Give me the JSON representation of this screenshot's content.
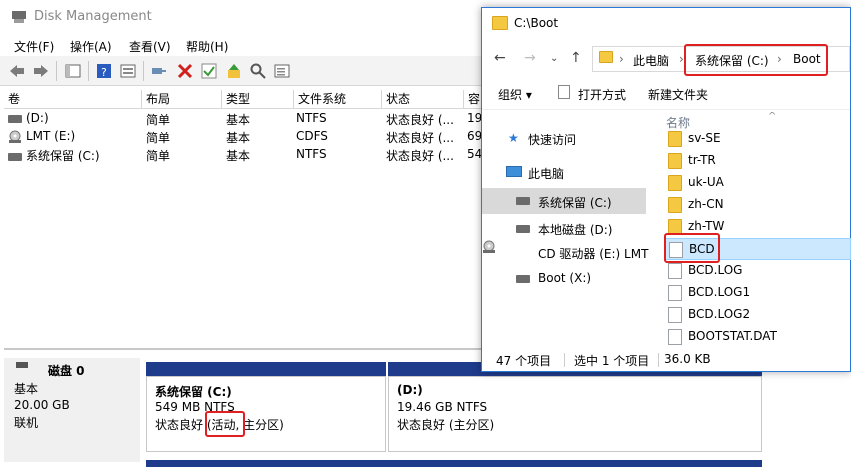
{
  "disk_management": {
    "title": "Disk Management",
    "menu": [
      "文件(F)",
      "操作(A)",
      "查看(V)",
      "帮助(H)"
    ],
    "columns": [
      "卷",
      "布局",
      "类型",
      "文件系统",
      "状态",
      "容"
    ],
    "volumes": [
      {
        "name": "(D:)",
        "layout": "简单",
        "type": "基本",
        "fs": "NTFS",
        "status": "状态良好 (...",
        "cap": "19"
      },
      {
        "name": "LMT (E:)",
        "layout": "简单",
        "type": "基本",
        "fs": "CDFS",
        "status": "状态良好 (...",
        "cap": "69"
      },
      {
        "name": "系统保留 (C:)",
        "layout": "简单",
        "type": "基本",
        "fs": "NTFS",
        "status": "状态良好 (...",
        "cap": "54"
      }
    ],
    "disk": {
      "name": "磁盘 0",
      "type": "基本",
      "size": "20.00 GB",
      "state": "联机"
    },
    "partitions": [
      {
        "name": "系统保留  (C:)",
        "size": "549 MB NTFS",
        "status": "状态良好 (活动, 主分区)"
      },
      {
        "name": "(D:)",
        "size": "19.46 GB NTFS",
        "status": "状态良好 (主分区)"
      }
    ]
  },
  "explorer": {
    "title": "C:\\Boot",
    "address": [
      "此电脑",
      "系统保留 (C:)",
      "Boot"
    ],
    "commands": {
      "organize": "组织",
      "open_with": "打开方式",
      "new_folder": "新建文件夹"
    },
    "nav": [
      {
        "label": "快速访问",
        "icon": "star-icon"
      },
      {
        "label": "此电脑",
        "icon": "computer-icon"
      },
      {
        "label": "系统保留 (C:)",
        "icon": "drive-icon",
        "selected": true
      },
      {
        "label": "本地磁盘 (D:)",
        "icon": "drive-icon"
      },
      {
        "label": "CD 驱动器 (E:) LMT",
        "icon": "cd-icon"
      },
      {
        "label": "Boot (X:)",
        "icon": "drive-icon"
      }
    ],
    "column_name": "名称",
    "files": [
      {
        "name": "sv-SE",
        "kind": "folder"
      },
      {
        "name": "tr-TR",
        "kind": "folder"
      },
      {
        "name": "uk-UA",
        "kind": "folder"
      },
      {
        "name": "zh-CN",
        "kind": "folder"
      },
      {
        "name": "zh-TW",
        "kind": "folder"
      },
      {
        "name": "BCD",
        "kind": "file",
        "selected": true
      },
      {
        "name": "BCD.LOG",
        "kind": "file"
      },
      {
        "name": "BCD.LOG1",
        "kind": "file"
      },
      {
        "name": "BCD.LOG2",
        "kind": "file"
      },
      {
        "name": "BOOTSTAT.DAT",
        "kind": "file"
      }
    ],
    "status": {
      "count": "47 个项目",
      "selected": "选中 1 个项目",
      "size": "36.0 KB"
    }
  },
  "colors": {
    "accent": "#2b79d6",
    "highlight": "#e02020",
    "partition_bar": "#1f3b8c",
    "selection": "#cce8ff"
  }
}
